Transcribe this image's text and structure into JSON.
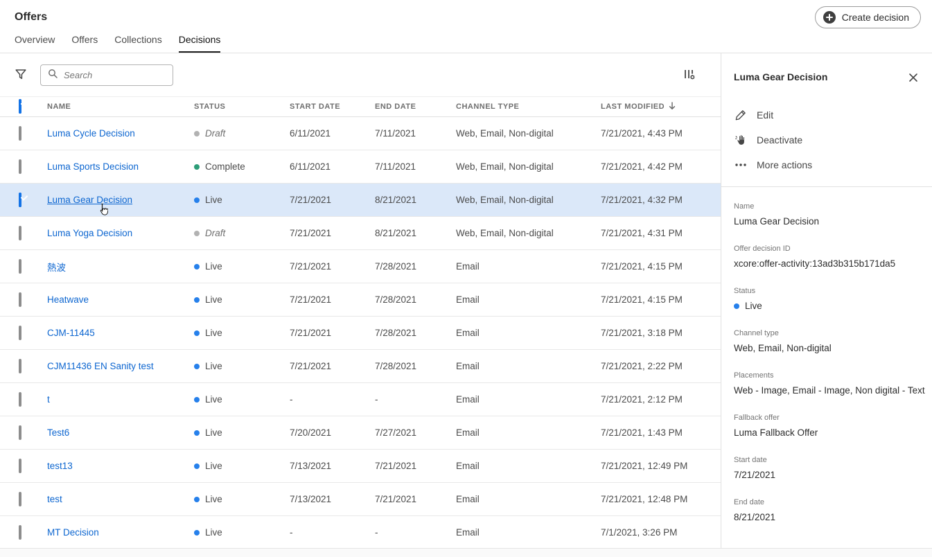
{
  "page": {
    "title": "Offers"
  },
  "header": {
    "create_button_label": "Create decision"
  },
  "tabs": [
    {
      "label": "Overview",
      "active": false
    },
    {
      "label": "Offers",
      "active": false
    },
    {
      "label": "Collections",
      "active": false
    },
    {
      "label": "Decisions",
      "active": true
    }
  ],
  "toolbar": {
    "search_placeholder": "Search"
  },
  "table": {
    "columns": [
      "NAME",
      "STATUS",
      "START DATE",
      "END DATE",
      "CHANNEL TYPE",
      "LAST MODIFIED"
    ],
    "sorted_column": "LAST MODIFIED",
    "sort_direction": "descending",
    "header_checkbox_state": "indeterminate",
    "rows": [
      {
        "name": "Luma Cycle Decision",
        "status": "Draft",
        "status_type": "draft",
        "start": "6/11/2021",
        "end": "7/11/2021",
        "channel": "Web, Email, Non-digital",
        "modified": "7/21/2021, 4:43 PM",
        "checked": false,
        "selected": false
      },
      {
        "name": "Luma Sports Decision",
        "status": "Complete",
        "status_type": "complete",
        "start": "6/11/2021",
        "end": "7/11/2021",
        "channel": "Web, Email, Non-digital",
        "modified": "7/21/2021, 4:42 PM",
        "checked": false,
        "selected": false
      },
      {
        "name": "Luma Gear Decision",
        "status": "Live",
        "status_type": "live",
        "start": "7/21/2021",
        "end": "8/21/2021",
        "channel": "Web, Email, Non-digital",
        "modified": "7/21/2021, 4:32 PM",
        "checked": true,
        "selected": true
      },
      {
        "name": "Luma Yoga Decision",
        "status": "Draft",
        "status_type": "draft",
        "start": "7/21/2021",
        "end": "8/21/2021",
        "channel": "Web, Email, Non-digital",
        "modified": "7/21/2021, 4:31 PM",
        "checked": false,
        "selected": false
      },
      {
        "name": "熱波",
        "status": "Live",
        "status_type": "live",
        "start": "7/21/2021",
        "end": "7/28/2021",
        "channel": "Email",
        "modified": "7/21/2021, 4:15 PM",
        "checked": false,
        "selected": false
      },
      {
        "name": "Heatwave",
        "status": "Live",
        "status_type": "live",
        "start": "7/21/2021",
        "end": "7/28/2021",
        "channel": "Email",
        "modified": "7/21/2021, 4:15 PM",
        "checked": false,
        "selected": false
      },
      {
        "name": "CJM-11445",
        "status": "Live",
        "status_type": "live",
        "start": "7/21/2021",
        "end": "7/28/2021",
        "channel": "Email",
        "modified": "7/21/2021, 3:18 PM",
        "checked": false,
        "selected": false
      },
      {
        "name": "CJM11436 EN Sanity test",
        "status": "Live",
        "status_type": "live",
        "start": "7/21/2021",
        "end": "7/28/2021",
        "channel": "Email",
        "modified": "7/21/2021, 2:22 PM",
        "checked": false,
        "selected": false
      },
      {
        "name": "t",
        "status": "Live",
        "status_type": "live",
        "start": "-",
        "end": "-",
        "channel": "Email",
        "modified": "7/21/2021, 2:12 PM",
        "checked": false,
        "selected": false
      },
      {
        "name": "Test6",
        "status": "Live",
        "status_type": "live",
        "start": "7/20/2021",
        "end": "7/27/2021",
        "channel": "Email",
        "modified": "7/21/2021, 1:43 PM",
        "checked": false,
        "selected": false
      },
      {
        "name": "test13",
        "status": "Live",
        "status_type": "live",
        "start": "7/13/2021",
        "end": "7/21/2021",
        "channel": "Email",
        "modified": "7/21/2021, 12:49 PM",
        "checked": false,
        "selected": false
      },
      {
        "name": "test",
        "status": "Live",
        "status_type": "live",
        "start": "7/13/2021",
        "end": "7/21/2021",
        "channel": "Email",
        "modified": "7/21/2021, 12:48 PM",
        "checked": false,
        "selected": false
      },
      {
        "name": "MT Decision",
        "status": "Live",
        "status_type": "live",
        "start": "-",
        "end": "-",
        "channel": "Email",
        "modified": "7/1/2021, 3:26 PM",
        "checked": false,
        "selected": false
      }
    ]
  },
  "panel": {
    "title": "Luma Gear Decision",
    "actions": [
      {
        "label": "Edit",
        "icon": "edit-pencil-icon"
      },
      {
        "label": "Deactivate",
        "icon": "deactivate-hand-icon"
      },
      {
        "label": "More actions",
        "icon": "more-actions-dots-icon"
      }
    ],
    "fields": [
      {
        "label": "Name",
        "value": "Luma Gear Decision"
      },
      {
        "label": "Offer decision ID",
        "value": "xcore:offer-activity:13ad3b315b171da5"
      },
      {
        "label": "Status",
        "value": "Live",
        "dot": "live"
      },
      {
        "label": "Channel type",
        "value": "Web, Email, Non-digital"
      },
      {
        "label": "Placements",
        "value": "Web - Image, Email - Image, Non digital - Text"
      },
      {
        "label": "Fallback offer",
        "value": "Luma Fallback Offer"
      },
      {
        "label": "Start date",
        "value": "7/21/2021"
      },
      {
        "label": "End date",
        "value": "8/21/2021"
      }
    ]
  },
  "icons": {
    "filter": "funnel shape",
    "search": "magnifier",
    "column-settings": "bars with gear",
    "sort": "down arrow",
    "create": "plus in dark circle",
    "close": "x cross",
    "more-actions": "three dots"
  },
  "colors": {
    "accent_blue": "#1473e6",
    "link_blue": "#0d66d0",
    "status_live": "#2680eb",
    "status_complete": "#2d9d78",
    "status_draft": "#b2b2b2",
    "selected_row_bg": "#dbe8f9",
    "border": "#e1e1e1"
  }
}
